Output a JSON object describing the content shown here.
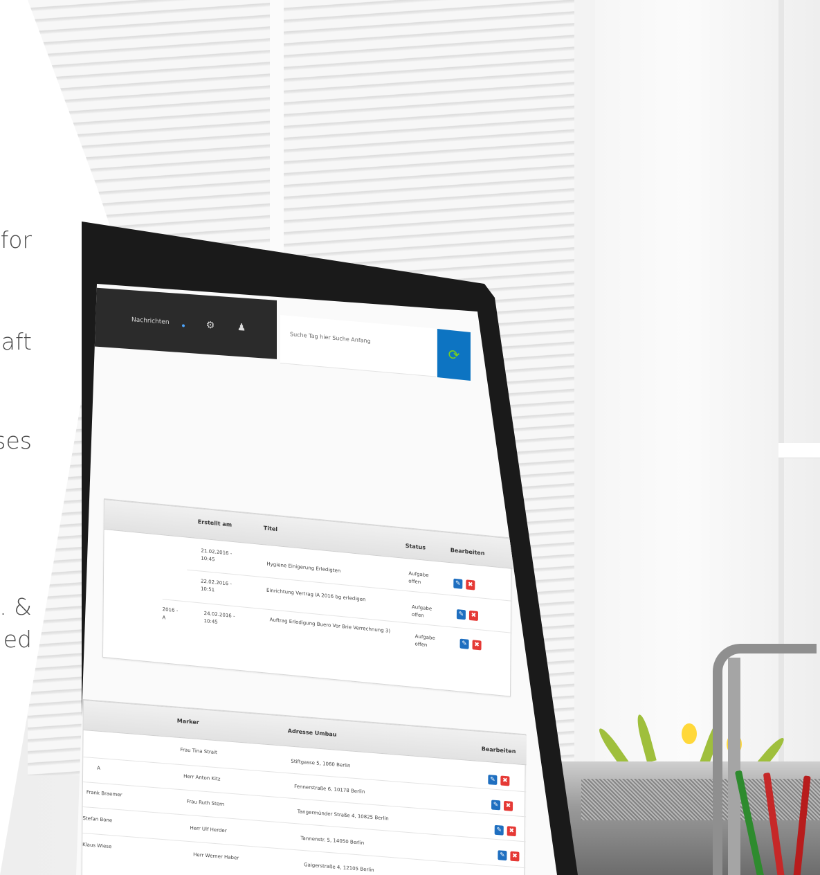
{
  "side_text": [
    "for",
    "aft",
    "ses",
    ". &",
    "ed"
  ],
  "app": {
    "topbar": {
      "label": "Nachrichten",
      "icons": [
        "network-icon",
        "bell-icon"
      ]
    },
    "search": {
      "text": "Suche Tag hier Suche Anfang",
      "button_icon": "search-icon"
    },
    "table1": {
      "columns": [
        "Erstellt am",
        "Titel",
        "Status",
        "Bearbeiten"
      ],
      "rows": [
        {
          "date": "21.02.2016 - 10:45",
          "title": "Hygiene Einigerung Erledigten",
          "status": "Aufgabe offen"
        },
        {
          "date": "22.02.2016 - 10:51",
          "title": "Einrichtung Vertrag IA 2016 bg erledigen",
          "status": "Aufgabe offen"
        },
        {
          "date": "24.02.2016 - 10:45",
          "title": "Auftrag Erledigung Buero Vor Brie Verrechnung 3)",
          "status": "Aufgabe offen"
        }
      ],
      "left_fragments": [
        "2016 -",
        "A"
      ]
    },
    "table2": {
      "columns": [
        "Marker",
        "Adresse Umbau",
        "Bearbeiten"
      ],
      "rows": [
        {
          "left": "",
          "name": "Frau Tina Strait",
          "address": "Stiftgasse 5, 1060 Berlin"
        },
        {
          "left": "A",
          "name": "Herr Anton Kitz",
          "address": "Fennerstraße 6, 10178 Berlin"
        },
        {
          "left": "Frank Braemer",
          "name": "Frau Ruth Stern",
          "address": "Tangermünder Straße 4, 10825 Berlin"
        },
        {
          "left": "Stefan Bone",
          "name": "Herr Ulf Herder",
          "address": "Tannenstr. 5, 14050 Berlin"
        },
        {
          "left": "Klaus Wiese",
          "name": "Herr Werner Haber",
          "address": "Gaigerstraße 4, 12105 Berlin"
        }
      ]
    },
    "edit_icon": "edit-icon",
    "delete_icon": "delete-icon"
  },
  "colors": {
    "accent_blue": "#0d74c2",
    "delete_red": "#e53935",
    "topbar": "#2b2b2b",
    "search_icon_green": "#7bd11a"
  }
}
